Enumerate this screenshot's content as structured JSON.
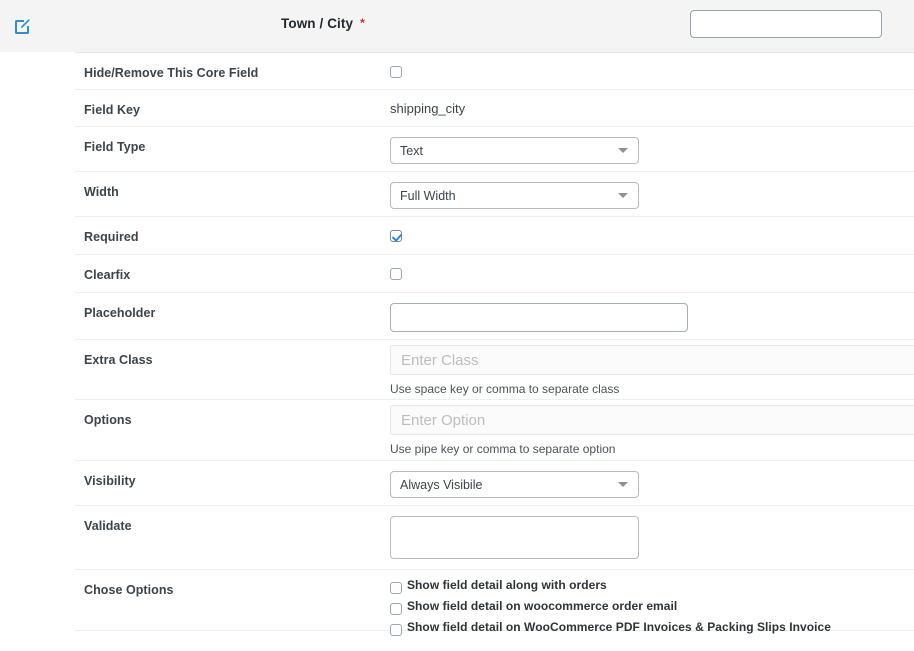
{
  "header": {
    "icon": "edit-square-icon",
    "title": "Town / City",
    "required_mark": "*",
    "label_input_value": "",
    "label_input_placeholder": ""
  },
  "accent_color": "#2b8ad6",
  "required_star_color": "#e02b2b",
  "rows": {
    "hide_remove": {
      "label": "Hide/Remove This Core Field",
      "checked": false
    },
    "field_key": {
      "label": "Field Key",
      "value": "shipping_city"
    },
    "field_type": {
      "label": "Field Type",
      "value": "Text"
    },
    "width": {
      "label": "Width",
      "value": "Full Width"
    },
    "required": {
      "label": "Required",
      "checked": true
    },
    "clearfix": {
      "label": "Clearfix",
      "checked": false
    },
    "placeholder": {
      "label": "Placeholder",
      "value": "",
      "input_placeholder": ""
    },
    "extra_class": {
      "label": "Extra Class",
      "value": "",
      "input_placeholder": "Enter Class",
      "hint": "Use space key or comma to separate class"
    },
    "options": {
      "label": "Options",
      "value": "",
      "input_placeholder": "Enter Option",
      "hint": "Use pipe key or comma to separate option"
    },
    "visibility": {
      "label": "Visibility",
      "value": "Always Visibile"
    },
    "validate": {
      "label": "Validate",
      "value": "",
      "input_placeholder": ""
    },
    "chose_options": {
      "label": "Chose Options",
      "items": [
        {
          "label": "Show field detail along with orders",
          "checked": false
        },
        {
          "label": "Show field detail on woocommerce order email",
          "checked": false
        },
        {
          "label": "Show field detail on WooCommerce PDF Invoices & Packing Slips Invoice",
          "checked": false
        }
      ]
    }
  }
}
